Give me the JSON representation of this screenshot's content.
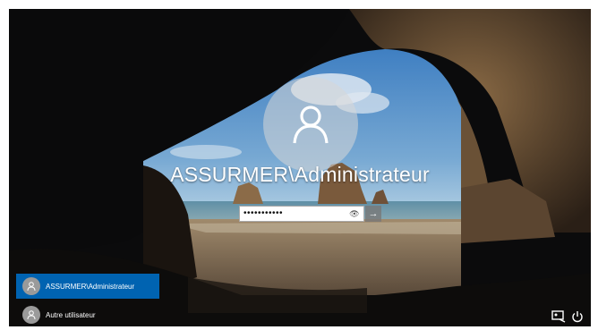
{
  "login": {
    "username": "ASSURMER\\Administrateur",
    "password_masked": "•••••••••••",
    "reveal_glyph": "👁",
    "submit_glyph": "→"
  },
  "users": [
    {
      "label": "ASSURMER\\Administrateur",
      "selected": true
    },
    {
      "label": "Autre utilisateur",
      "selected": false
    }
  ],
  "icons": {
    "ease_of_access": "ease-of-access-icon",
    "power": "power-icon"
  },
  "colors": {
    "selected_user": "#0063b1"
  }
}
